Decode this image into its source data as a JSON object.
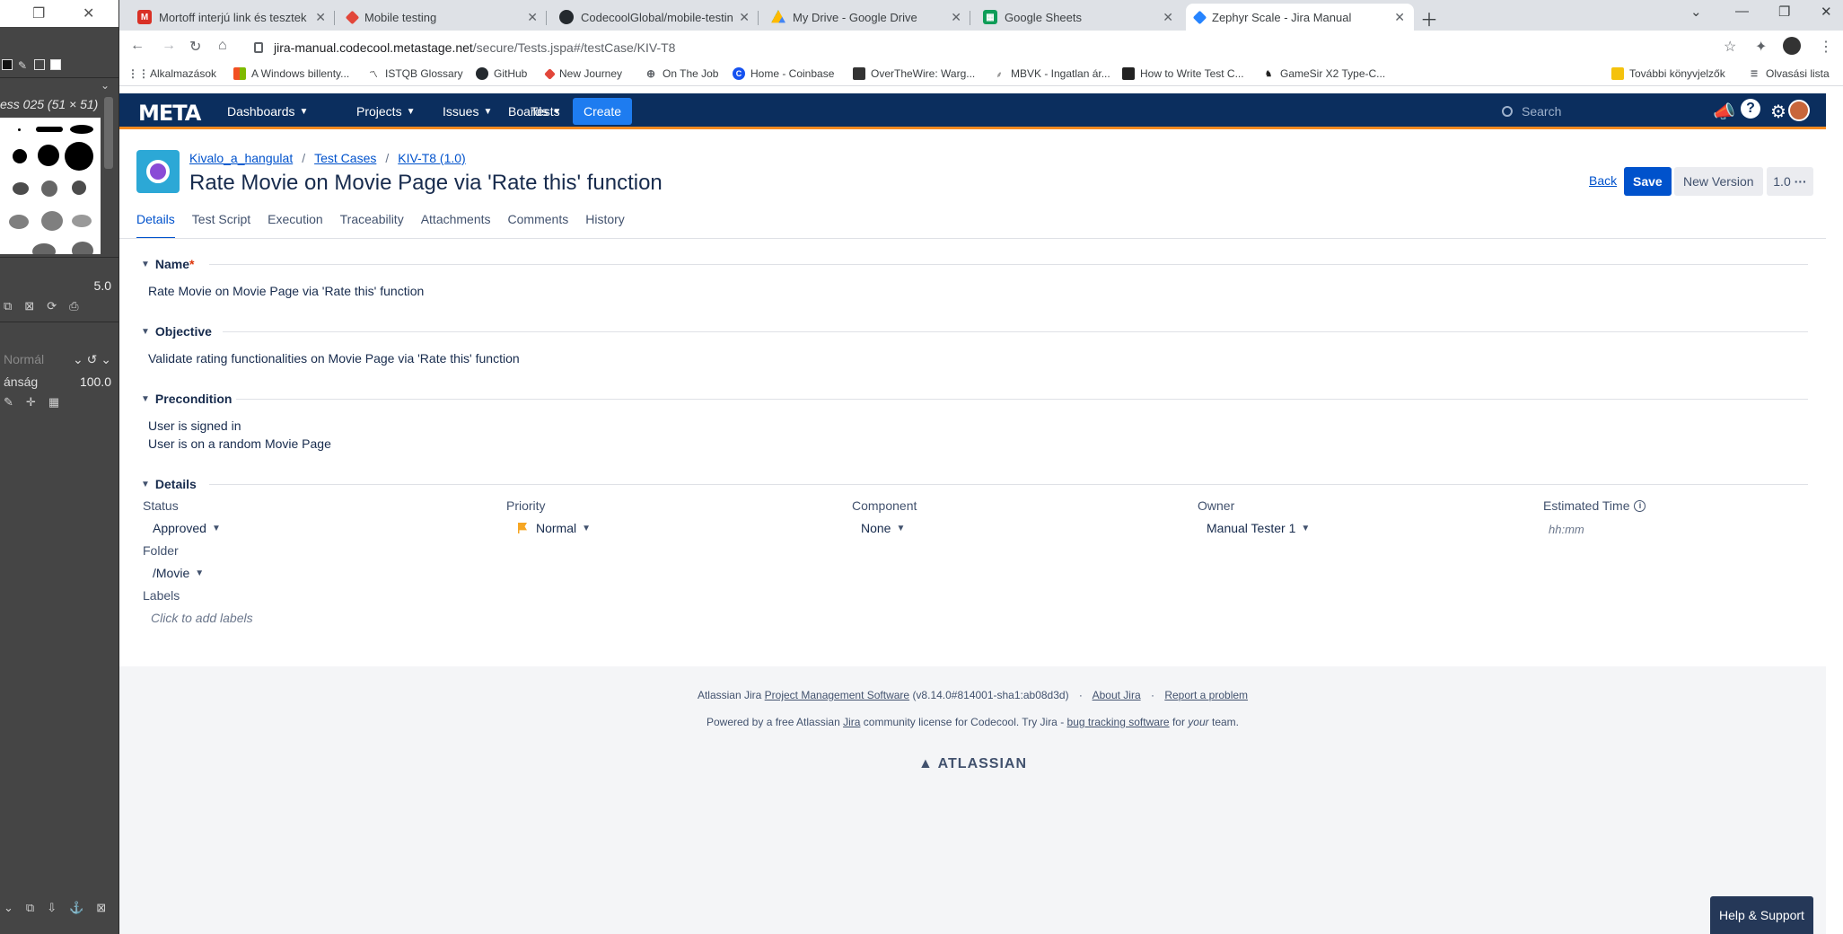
{
  "gimp": {
    "brush_name": "ess 025 (51 × 51)",
    "spacing_value": "5.0",
    "mode_label": "Normál",
    "opacity_label": "ánság",
    "opacity_value": "100.0"
  },
  "browser": {
    "tabs": [
      {
        "title": "Mortoff interjú link és tesztek - c",
        "icon": "gmail-icon",
        "color": "#d93025"
      },
      {
        "title": "Mobile testing",
        "icon": "zephyr-icon",
        "color": "#e2463a"
      },
      {
        "title": "CodecoolGlobal/mobile-testing-",
        "icon": "github-icon",
        "color": "#24292e"
      },
      {
        "title": "My Drive - Google Drive",
        "icon": "drive-icon",
        "color": "#1ea362"
      },
      {
        "title": "Google Sheets",
        "icon": "sheets-icon",
        "color": "#0f9d58"
      },
      {
        "title": "Zephyr Scale - Jira Manual",
        "icon": "zephyr-icon",
        "color": "#2684ff"
      }
    ],
    "url_host": "jira-manual.codecool.metastage.net",
    "url_path": "/secure/Tests.jspa#/testCase/KIV-T8",
    "bookmarks": [
      {
        "label": "Alkalmazások",
        "icon": "apps-grid-icon",
        "color": "#5f6368"
      },
      {
        "label": "A Windows billenty...",
        "icon": "windows-icon",
        "color": "#f25022"
      },
      {
        "label": "ISTQB Glossary",
        "icon": "istqb-icon",
        "color": "#444"
      },
      {
        "label": "GitHub",
        "icon": "github-icon",
        "color": "#24292e"
      },
      {
        "label": "New Journey",
        "icon": "zephyr-icon",
        "color": "#e2463a"
      },
      {
        "label": "On The Job",
        "icon": "globe-icon",
        "color": "#5f6368"
      },
      {
        "label": "Home - Coinbase",
        "icon": "coinbase-icon",
        "color": "#1652f0"
      },
      {
        "label": "OverTheWire: Warg...",
        "icon": "overthewire-icon",
        "color": "#333"
      },
      {
        "label": "MBVK - Ingatlan ár...",
        "icon": "feather-icon",
        "color": "#999"
      },
      {
        "label": "How to Write Test C...",
        "icon": "bookmark-site-icon",
        "color": "#222"
      },
      {
        "label": "GameSir X2 Type-C...",
        "icon": "gamesir-icon",
        "color": "#222"
      }
    ],
    "other_bookmarks": "További könyvjelzők",
    "reading_list": "Olvasási lista"
  },
  "jira": {
    "logo": "META",
    "nav": [
      {
        "label": "Dashboards",
        "dropdown": true
      },
      {
        "label": "Projects",
        "dropdown": true
      },
      {
        "label": "Issues",
        "dropdown": true
      },
      {
        "label": "Boards",
        "dropdown": true
      },
      {
        "label": "Tests",
        "dropdown": false
      }
    ],
    "create_label": "Create",
    "search_placeholder": "Search",
    "breadcrumb": [
      "Kivalo_a_hangulat",
      "Test Cases",
      "KIV-T8 (1.0)"
    ],
    "title": "Rate Movie on Movie Page via 'Rate this' function",
    "back_label": "Back",
    "save_label": "Save",
    "new_version_label": "New Version",
    "version_label": "1.0",
    "tabs": [
      "Details",
      "Test Script",
      "Execution",
      "Traceability",
      "Attachments",
      "Comments",
      "History"
    ],
    "active_tab": "Details",
    "sections": {
      "name": {
        "heading": "Name",
        "required_mark": "*",
        "value": "Rate Movie on Movie Page via 'Rate this' function"
      },
      "objective": {
        "heading": "Objective",
        "value": "Validate rating functionalities on Movie Page via 'Rate this' function"
      },
      "precondition": {
        "heading": "Precondition",
        "lines": [
          "User is signed in",
          "User is on a random Movie Page"
        ]
      },
      "details": {
        "heading": "Details",
        "status_label": "Status",
        "status_value": "Approved",
        "priority_label": "Priority",
        "priority_value": "Normal",
        "priority_color": "#f6a623",
        "component_label": "Component",
        "component_value": "None",
        "owner_label": "Owner",
        "owner_value": "Manual Tester 1",
        "estimated_label": "Estimated Time",
        "estimated_placeholder": "hh:mm",
        "folder_label": "Folder",
        "folder_value": "/Movie",
        "labels_label": "Labels",
        "labels_placeholder": "Click to add labels"
      }
    },
    "footer": {
      "line1_prefix": "Atlassian Jira",
      "line1_link": "Project Management Software",
      "line1_version": "(v8.14.0#814001-sha1:ab08d3d)",
      "about": "About Jira",
      "report": "Report a problem",
      "line2_prefix": "Powered by a free Atlassian",
      "line2_jira": "Jira",
      "line2_mid": "community license for Codecool. Try Jira -",
      "line2_link": "bug tracking software",
      "line2_for": "for",
      "line2_your": "your",
      "line2_end": "team.",
      "logo": "ATLASSIAN"
    },
    "help_label": "Help & Support"
  }
}
